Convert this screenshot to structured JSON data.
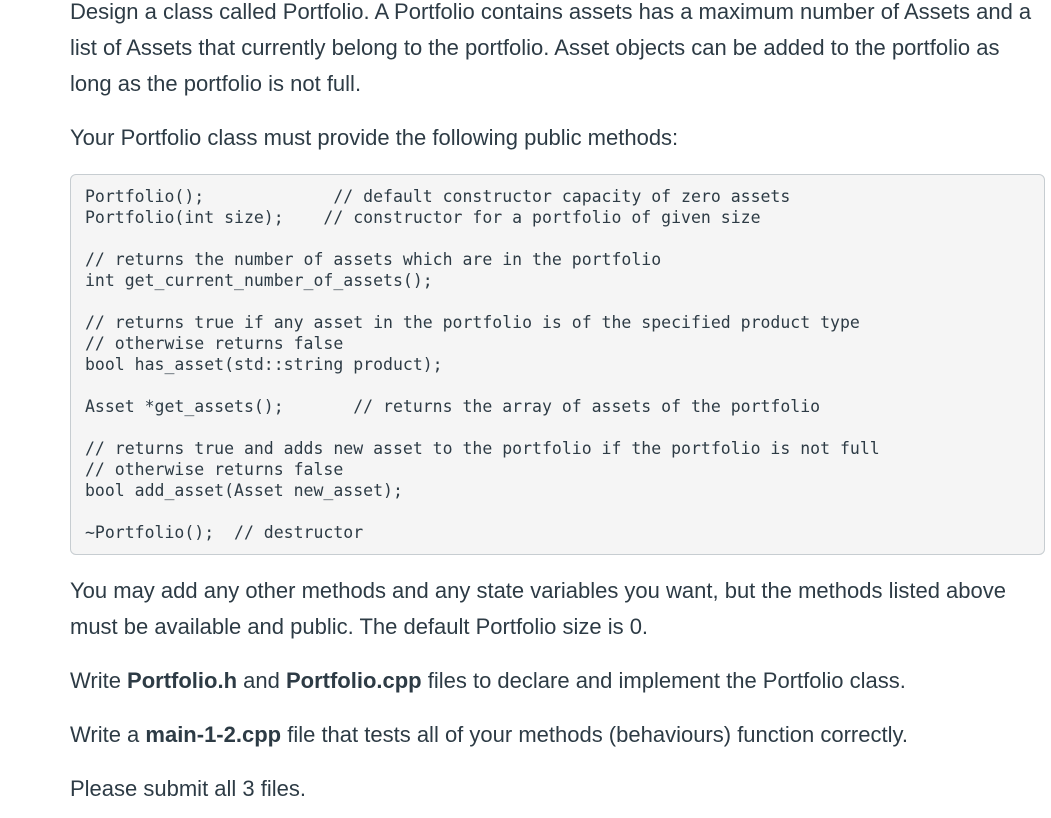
{
  "intro": {
    "text": "Design a class called Portfolio.  A Portfolio contains assets has a maximum number of Assets and a list of Assets that currently belong to the portfolio.  Asset objects can be added to the portfolio as long as the portfolio is not full."
  },
  "methods_lead": "Your Portfolio class must provide the following public methods:",
  "code": {
    "blocks": [
      [
        "Portfolio();             // default constructor capacity of zero assets",
        "Portfolio(int size);    // constructor for a portfolio of given size"
      ],
      [
        "// returns the number of assets which are in the portfolio",
        "int get_current_number_of_assets();"
      ],
      [
        "// returns true if any asset in the portfolio is of the specified product type",
        "// otherwise returns false",
        "bool has_asset(std::string product);"
      ],
      [
        "Asset *get_assets();       // returns the array of assets of the portfolio"
      ],
      [
        "// returns true and adds new asset to the portfolio if the portfolio is not full",
        "// otherwise returns false",
        "bool add_asset(Asset new_asset);"
      ],
      [
        "~Portfolio();  // destructor"
      ]
    ]
  },
  "note": "You may add any other methods and any state variables you want, but the methods listed above must be available and public. The default Portfolio size is 0.",
  "write_files": {
    "prefix": "Write ",
    "file1": "Portfolio.h",
    "middle": " and ",
    "file2": "Portfolio.cpp",
    "suffix": " files to declare and implement the Portfolio class."
  },
  "write_main": {
    "prefix": "Write a ",
    "file": "main-1-2.cpp",
    "suffix": " file that tests all of your methods (behaviours) function correctly."
  },
  "submit": "Please submit all 3 files."
}
